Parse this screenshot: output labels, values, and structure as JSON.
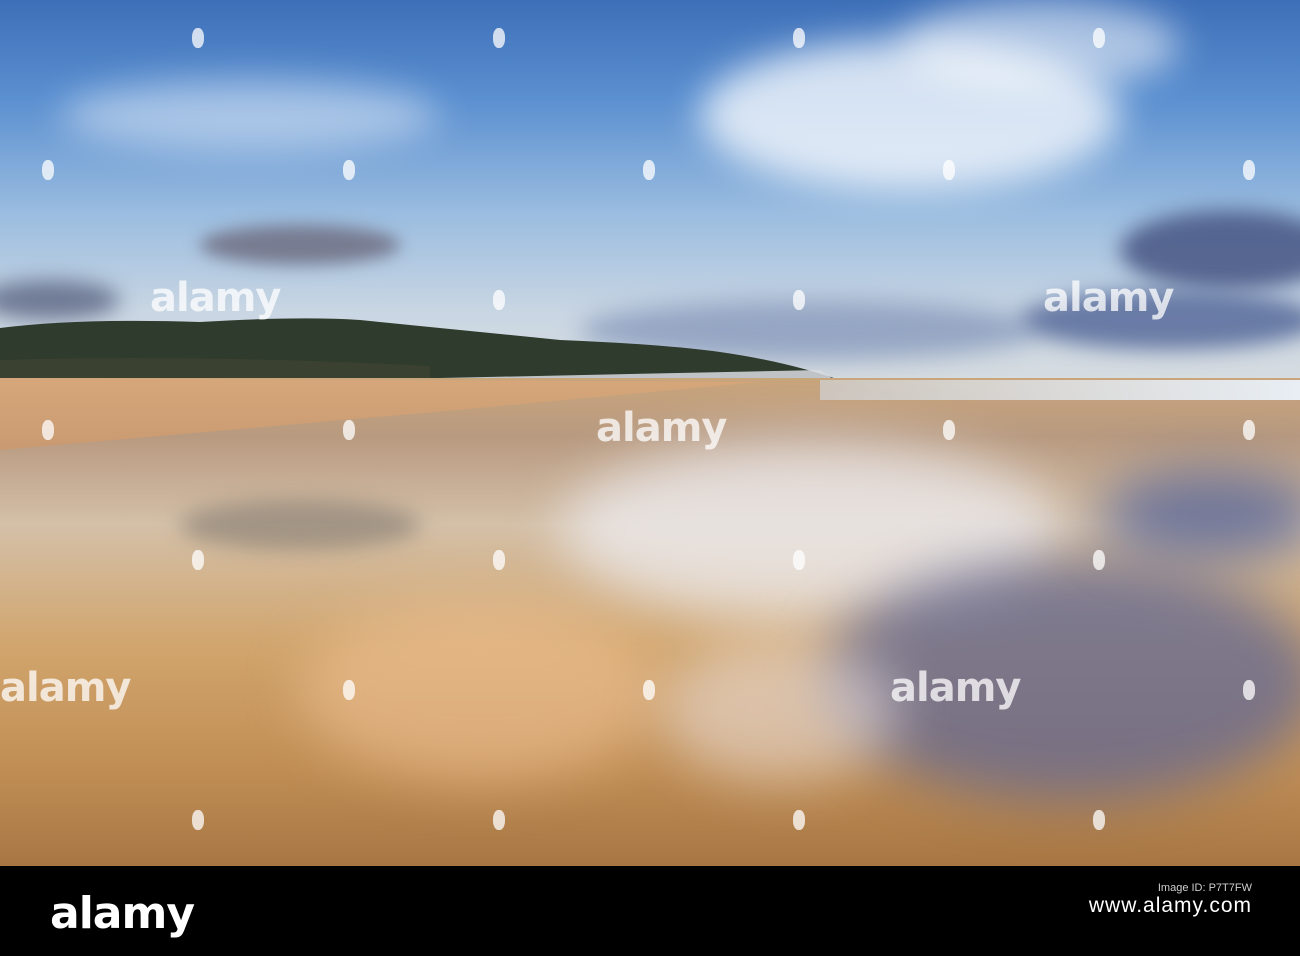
{
  "image": {
    "description_tags": [
      "beach",
      "sky-reflection",
      "hill",
      "sea"
    ],
    "colors": {
      "sky_top": "#3d6fb8",
      "sand": "#c9a57c",
      "strip": "#000000"
    }
  },
  "watermark": {
    "text": "alamy"
  },
  "footer": {
    "brand": "alamy",
    "image_id_label": "Image ID: P7T7FW",
    "image_id_code": "www.alamy.com"
  }
}
